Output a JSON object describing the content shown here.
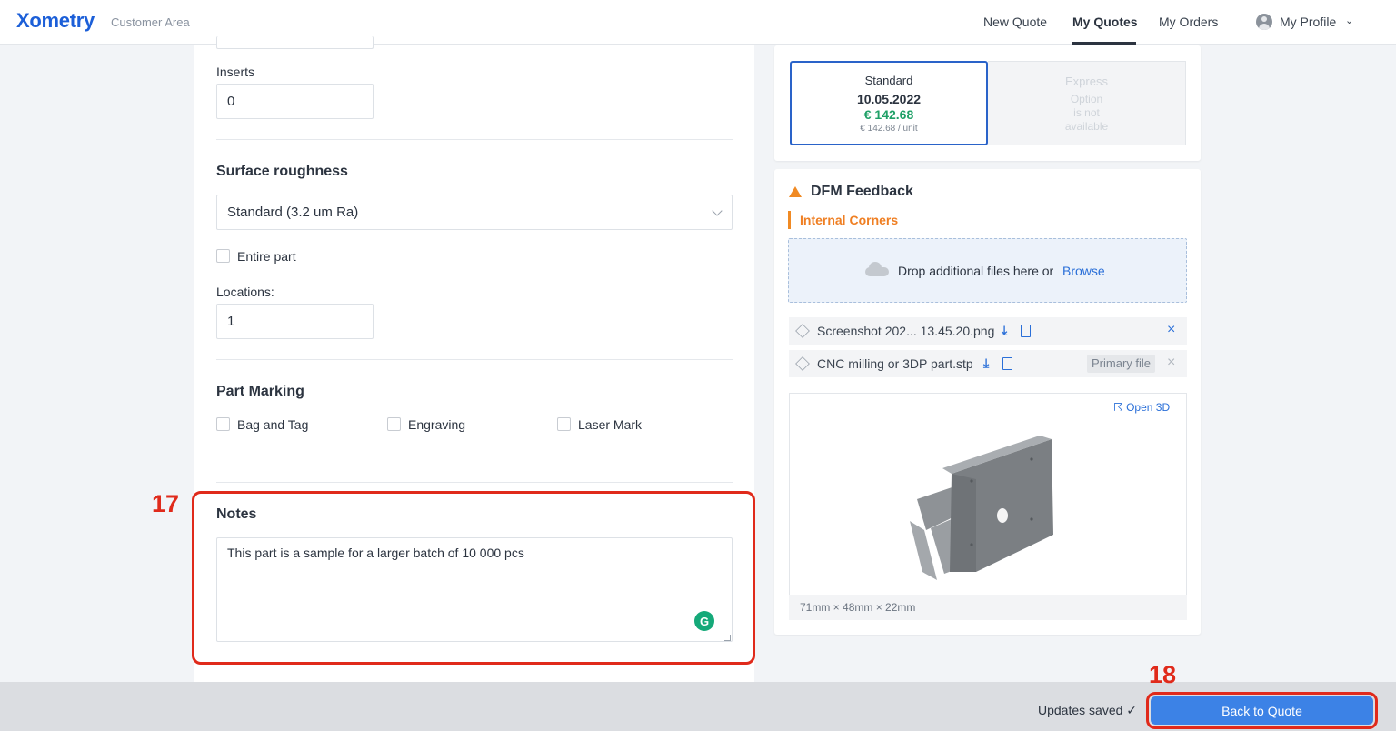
{
  "header": {
    "logo": "Xometry",
    "area": "Customer Area",
    "nav": [
      "New Quote",
      "My Quotes",
      "My Orders",
      "My Profile"
    ]
  },
  "form": {
    "inserts_label": "Inserts",
    "inserts_value": "0",
    "surface_title": "Surface roughness",
    "surface_value": "Standard (3.2 um Ra)",
    "entire_part_label": "Entire part",
    "locations_label": "Locations:",
    "locations_value": "1",
    "marking_title": "Part Marking",
    "marking_options": [
      "Bag and Tag",
      "Engraving",
      "Laser Mark"
    ],
    "notes_title": "Notes",
    "notes_value": "This part is a sample for a larger batch of 10 000 pcs"
  },
  "delivery": {
    "standard_title": "Standard",
    "standard_date": "10.05.2022",
    "standard_price": "€ 142.68",
    "standard_unit": "€ 142.68 / unit",
    "express_title": "Express",
    "express_text": [
      "Option",
      "is not",
      "available"
    ]
  },
  "dfm": {
    "title": "DFM Feedback",
    "issue": "Internal Corners",
    "drop_text": "Drop additional files here or",
    "browse": "Browse",
    "files": [
      {
        "name": "Screenshot 202... 13.45.20.png",
        "badge": ""
      },
      {
        "name": "CNC milling or 3DP part.stp",
        "badge": "Primary file"
      }
    ],
    "open3d": "Open 3D",
    "dimensions": "71mm × 48mm × 22mm"
  },
  "annotations": {
    "notes_number": "17",
    "back_number": "18"
  },
  "footer": {
    "saved": "Updates saved ✓",
    "back_button": "Back to Quote"
  },
  "colors": {
    "accent": "#3c82e6",
    "price": "#1fa067",
    "warning": "#f08a24",
    "annotation": "#e02a1b"
  }
}
